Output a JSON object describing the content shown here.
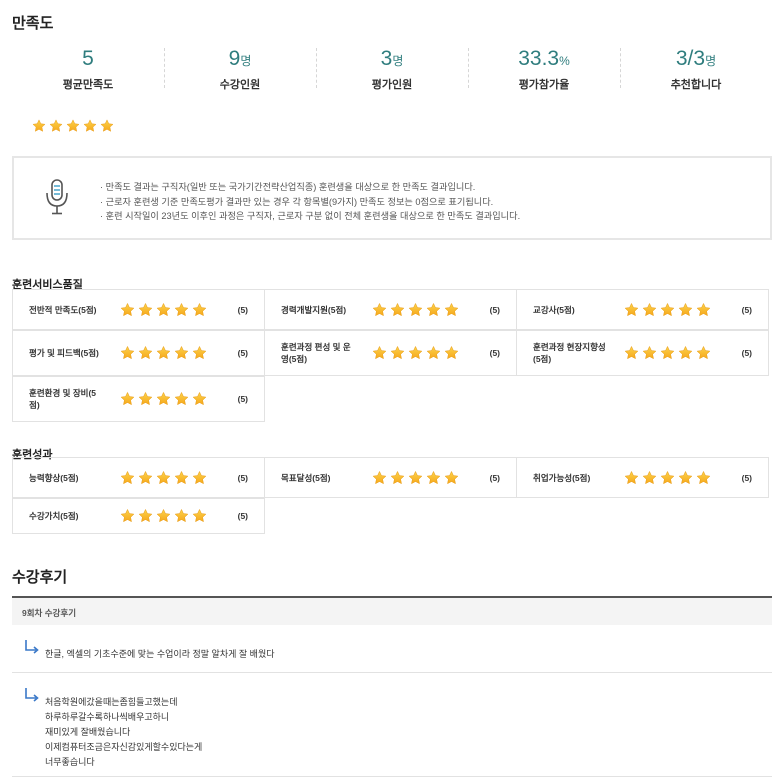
{
  "satisfaction": {
    "title": "만족도",
    "summary": [
      {
        "value": "5",
        "unit": "",
        "label": "평균만족도"
      },
      {
        "value": "9",
        "unit": "명",
        "label": "수강인원"
      },
      {
        "value": "3",
        "unit": "명",
        "label": "평가인원"
      },
      {
        "value": "33.3",
        "unit": "%",
        "label": "평가참가율"
      },
      {
        "value": "3/3",
        "unit": "명",
        "label": "추천합니다"
      }
    ],
    "rating": 5,
    "notice": [
      "· 만족도 결과는 구직자(일반 또는 국가기간전략산업직종) 훈련생을 대상으로 한 만족도 결과입니다.",
      "· 근로자 훈련생 기준 만족도평가 결과만 있는 경우 각 항목별(9가지) 만족도 정보는 0점으로 표기됩니다.",
      "· 훈련 시작일이 23년도 이후인 과정은 구직자, 근로자 구분 없이 전체 훈련생을 대상으로 한 만족도 결과입니다."
    ]
  },
  "service": {
    "title": "훈련서비스품질",
    "items": [
      {
        "name": "전반적 만족도(5점)",
        "score": "(5)"
      },
      {
        "name": "경력개발지원(5점)",
        "score": "(5)"
      },
      {
        "name": "교강사(5점)",
        "score": "(5)"
      },
      {
        "name": "평가 및 피드백(5점)",
        "score": "(5)"
      },
      {
        "name": "훈련과정 편성 및 운영(5점)",
        "score": "(5)"
      },
      {
        "name": "훈련과정 현장지향성(5점)",
        "score": "(5)"
      },
      {
        "name": "훈련환경 및 장비(5점)",
        "score": "(5)"
      }
    ]
  },
  "outcome": {
    "title": "훈련성과",
    "items": [
      {
        "name": "능력향상(5점)",
        "score": "(5)"
      },
      {
        "name": "목표달성(5점)",
        "score": "(5)"
      },
      {
        "name": "취업가능성(5점)",
        "score": "(5)"
      },
      {
        "name": "수강가치(5점)",
        "score": "(5)"
      }
    ]
  },
  "reviews": {
    "title": "수강후기",
    "round_label": "9회차 수강후기",
    "items": [
      {
        "lines": [
          "한글, 엑셀의 기초수준에 맞는 수업이라 정말 알차게 잘 배웠다"
        ]
      },
      {
        "lines": [
          "처음학원에갔을때는좀힘들고했는데",
          "하루하루갈수록하나씩배우고하니",
          "재미있게 잘배웠습니다",
          "이제컴퓨터조금은자신감있게할수있다는게",
          "너무좋습니다"
        ]
      }
    ]
  },
  "colors": {
    "accent": "#2f7d7e",
    "star": "#f6a81c",
    "arrow": "#3a78c8"
  }
}
